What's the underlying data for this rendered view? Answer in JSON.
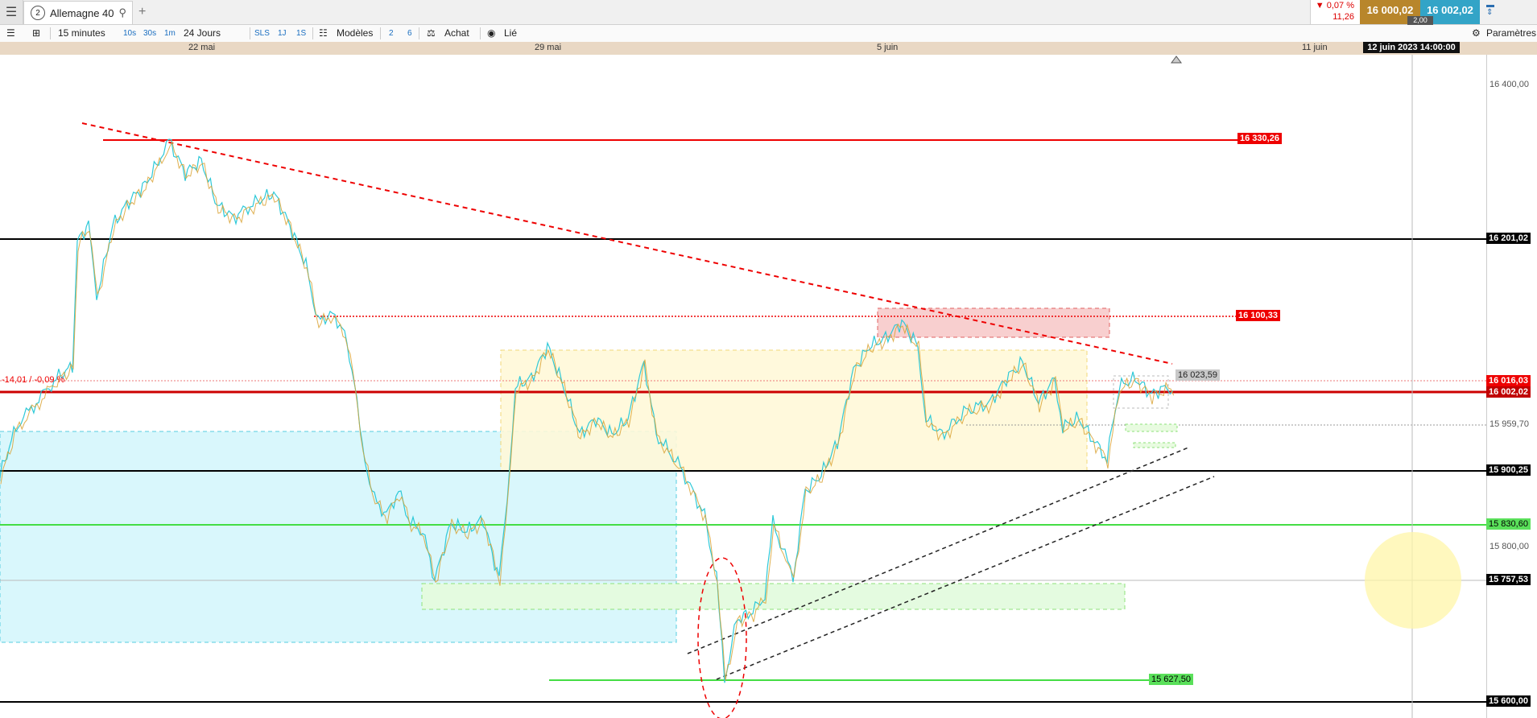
{
  "topbar": {
    "menu_icon": "hamburger-icon",
    "instrument_number": "2",
    "instrument_name": "Allemagne 40",
    "search_icon": "search-icon",
    "add_tab": "+",
    "change_pct": "▼ 0,07 %",
    "change_abs": "11,26",
    "bid": "16 000,02",
    "ask": "16 002,02",
    "spread": "2,00"
  },
  "toolbar": {
    "timeframe": "15 minutes",
    "intervals": [
      "10s",
      "30s",
      "1m"
    ],
    "period": "24 Jours",
    "modes": [
      "SLS",
      "1J",
      "1S"
    ],
    "models": "Modèles",
    "quick": [
      "2",
      "6"
    ],
    "buy": "Achat",
    "linked": "Lié",
    "settings": "Paramètres"
  },
  "time_axis": {
    "labels": [
      "22 mai",
      "29 mai",
      "5 juin",
      "11 juin"
    ],
    "cursor": "12 juin 2023 14:00:00"
  },
  "price_axis": {
    "ticks": [
      "16 400,00",
      "15 800,00"
    ],
    "badges": {
      "r16201": "16 201,02",
      "r16016": "16 016,03",
      "last": "16 002,02",
      "r15959": "15 959,70",
      "r15900": "15 900,25",
      "r15830": "15 830,60",
      "r15757": "15 757,53",
      "r15600": "15 600,00"
    }
  },
  "levels": {
    "l16330": "16 330,26",
    "l16100": "16 100,33",
    "l16023": "16 023,59",
    "l15627": "15 627,50",
    "diff_label": "-14,01 / -0,09 %"
  },
  "colors": {
    "bid": "#b8862b",
    "ask": "#33a4c7",
    "support": "#5ae05a",
    "resistance": "#e00000"
  }
}
